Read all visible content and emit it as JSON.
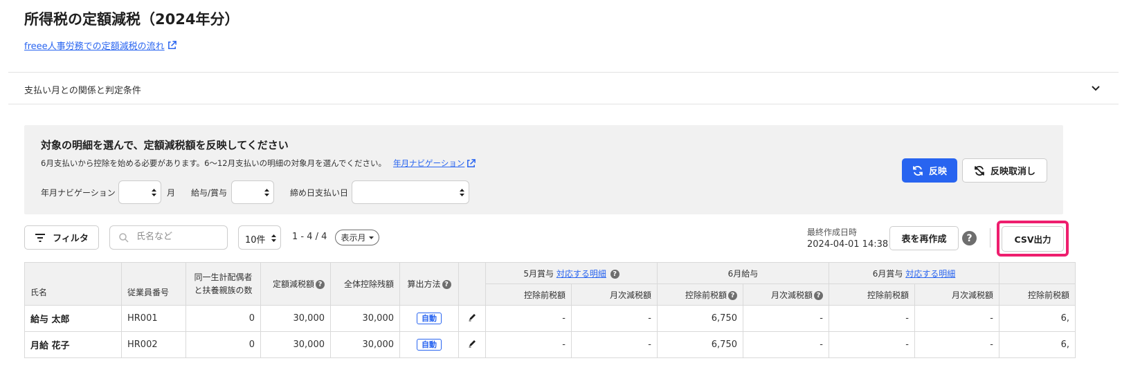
{
  "page": {
    "title": "所得税の定額減税（2024年分）",
    "flow_link": "freee人事労務での定額減税の流れ"
  },
  "accordion": {
    "label": "支払い月との関係と判定条件"
  },
  "panel": {
    "title": "対象の明細を選んで、定額減税額を反映してください",
    "description": "6月支払いから控除を始める必要があります。6〜12月支払いの明細の対象月を選んでください。",
    "nav_link": "年月ナビゲーション",
    "filters": {
      "year_month_label": "年月ナビゲーション",
      "month_suffix": "月",
      "pay_type_label": "給与/賞与",
      "closing_label": "締め日支払い日"
    },
    "apply_button": "反映",
    "cancel_button": "反映取消し"
  },
  "toolbar": {
    "filter_button": "フィルタ",
    "search_placeholder": "氏名など",
    "per_page": "10件",
    "range": "1 - 4 / 4",
    "display_month": "表示月",
    "last_created_label": "最終作成日時",
    "last_created_value": "2024-04-01 14:38",
    "regenerate_button": "表を再作成",
    "help": "?",
    "csv_button": "CSV出力"
  },
  "table": {
    "headers": {
      "name": "氏名",
      "employee_id": "従業員番号",
      "dependents": "同一生計配偶者と扶養親族の数",
      "fixed_reduction": "定額減税額",
      "total_remaining": "全体控除残額",
      "method": "算出方法",
      "pre_tax": "控除前税額",
      "monthly_reduction": "月次減税額"
    },
    "groups": [
      {
        "label": "5月賞与",
        "link": "対応する明細"
      },
      {
        "label": "6月給与",
        "link": ""
      },
      {
        "label": "6月賞与",
        "link": "対応する明細"
      },
      {
        "label": "",
        "link": ""
      }
    ],
    "rows": [
      {
        "name": "給与 太郎",
        "employee_id": "HR001",
        "dependents": "0",
        "fixed_reduction": "30,000",
        "total_remaining": "30,000",
        "method": "自動",
        "g1_pre": "-",
        "g1_month": "-",
        "g2_pre": "6,750",
        "g2_month": "-",
        "g3_pre": "-",
        "g3_month": "-",
        "g4_pre": "6,"
      },
      {
        "name": "月給 花子",
        "employee_id": "HR002",
        "dependents": "0",
        "fixed_reduction": "30,000",
        "total_remaining": "30,000",
        "method": "自動",
        "g1_pre": "-",
        "g1_month": "-",
        "g2_pre": "6,750",
        "g2_month": "-",
        "g3_pre": "-",
        "g3_month": "-",
        "g4_pre": "6,"
      }
    ]
  },
  "colors": {
    "accent": "#2864f0",
    "highlight": "#ee1e6e",
    "panel_bg": "#f1f1f1"
  }
}
